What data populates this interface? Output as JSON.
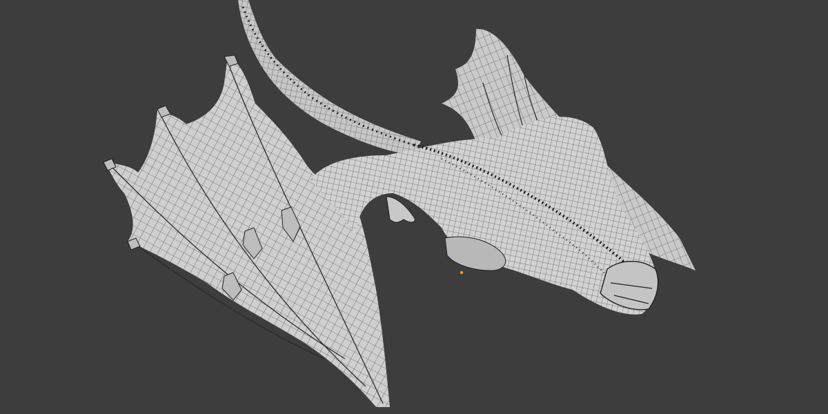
{
  "viewport": {
    "background_color": "#3d3d3d",
    "mesh_fill_color": "#cfcfcf",
    "mesh_shade_color": "#b3b3b3",
    "wire_color": "#2a2a2a",
    "origin_marker_color": "#f0a020"
  },
  "scene_object": {
    "icon": "dragon-mesh-icon"
  }
}
